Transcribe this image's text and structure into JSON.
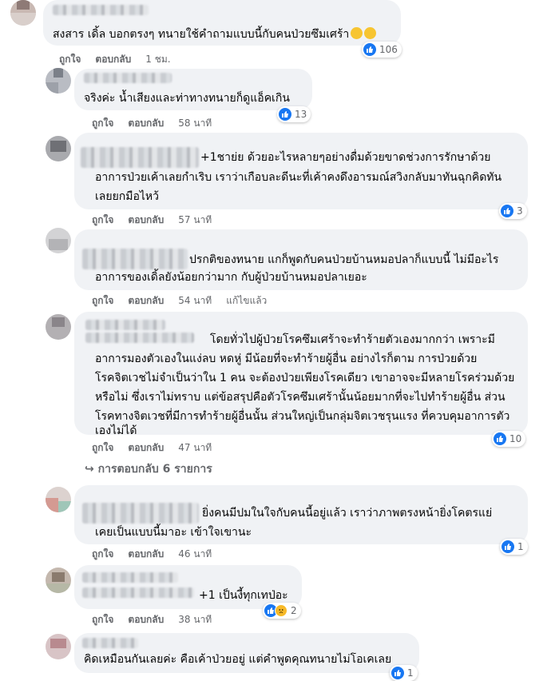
{
  "actions": {
    "like": "ถูกใจ",
    "reply": "ตอบกลับ"
  },
  "comments": [
    {
      "text": [
        "สงสาร เดิ้ล บอกตรงๆ ทนายใช้คำถามแบบนี้กับคนป่วยซึมเศร้า"
      ],
      "time": "1 ชม.",
      "reactions": "106"
    },
    {
      "text": [
        "จริงค่ะ น้ำเสียงและท่าทางทนายก็ดูแอ็คเกิน"
      ],
      "time": "58 นาที",
      "reactions": "13"
    },
    {
      "text": [
        "+1ชาย่ย ด้วยอะไรหลายๆอย่างดื่มด้วยขาดช่วงการรักษาด้วย",
        "อาการป่วยเค้าเลยกำเริบ เราว่าเกือบละดีนะที่เค้าคงดึงอารมณ์สวิงกลับมาทันฉุกคิดทัน",
        "เลยยกมือไหว้"
      ],
      "time": "57 นาที",
      "reactions": "3"
    },
    {
      "text": [
        "ปรกติของทนาย แกก็พูดกับคนป่วยบ้านหมอปลาก็แบบนี้ ไม่มีอะไร",
        "อาการของเดิ้ลยังน้อยกว่ามาก กับผู้ป่วยบ้านหมอปลาเยอะ"
      ],
      "time": "54 นาที",
      "edited": "แก้ไขแล้ว"
    },
    {
      "text": [
        "โดยทั่วไปผู้ป่วยโรคซึมเศร้าจะทำร้ายตัวเองมากกว่า เพราะมี",
        "อาการมองตัวเองในแง่ลบ หดหู่ มีน้อยที่จะทำร้ายผู้อื่น อย่างไรก็ตาม การป่วยด้วย",
        "โรคจิตเวชไม่จำเป็นว่าใน 1 คน จะต้องป่วยเพียงโรคเดียว เขาอาจจะมีหลายโรคร่วมด้วย",
        "หรือไม่ ซึ่งเราไม่ทราบ แต่ข้อสรุปคือตัวโรคซึมเศร้านั้นน้อยมากที่จะไปทำร้ายผู้อื่น ส่วน",
        "โรคทางจิตเวชที่มีการทำร้ายผู้อื่นนั้น ส่วนใหญ่เป็นกลุ่มจิตเวชรุนแรง ที่ควบคุมอาการตัว",
        "เองไม่ได้"
      ],
      "time": "47 นาที",
      "reactions": "10"
    },
    {
      "text": [
        "ยิ่งคนมีปมในใจกับคนนี้อยู่แล้ว เราว่าภาพตรงหน้ายิ่งโคตรแย่",
        "เคยเป็นแบบนี้มาอะ เข้าใจเขานะ"
      ],
      "time": "46 นาที",
      "reactions": "1"
    },
    {
      "text": [
        "+1 เป็นงี้ทุกเทป่อะ"
      ],
      "time": "38 นาที",
      "reactions": "2"
    },
    {
      "text": [
        "คิดเหมือนกันเลยค่ะ คือเค้าป่วยอยู่ แต่คำพูดคุณทนายไม่โอเคเลย"
      ],
      "reactions": "1"
    }
  ],
  "replies_link": "การตอบกลับ 6 รายการ",
  "colors": {
    "bubble": "#f0f2f5",
    "meta": "#65676b",
    "like": "#1877f2"
  }
}
